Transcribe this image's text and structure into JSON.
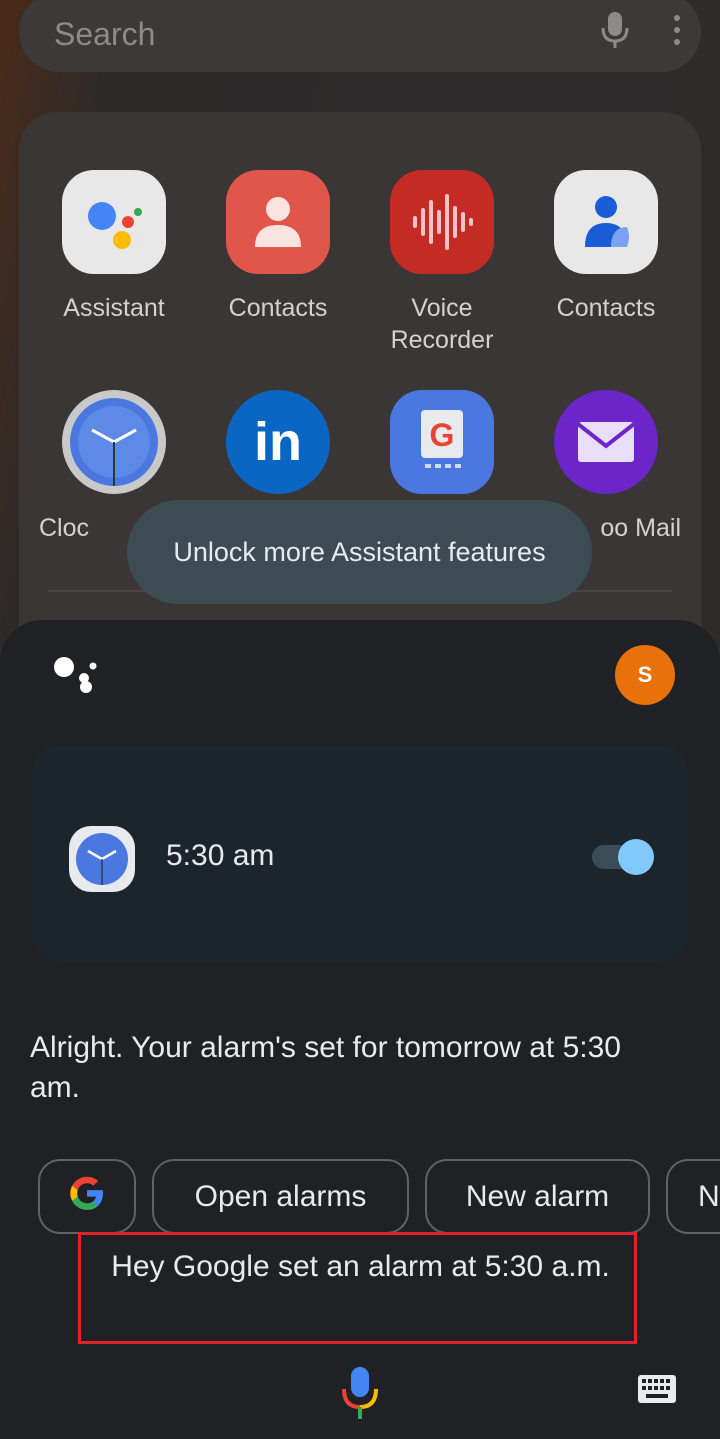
{
  "search": {
    "placeholder": "Search",
    "mic_icon": "mic-icon",
    "more_icon": "more-vert-icon"
  },
  "apps": [
    {
      "label": "Assistant",
      "icon": "google-assistant-icon",
      "color": "#e8e8e8"
    },
    {
      "label": "Contacts",
      "icon": "contacts-person-icon",
      "color": "#e0564a"
    },
    {
      "label": "Voice\nRecorder",
      "icon": "waveform-icon",
      "color": "#c52b25"
    },
    {
      "label": "Contacts",
      "icon": "contacts-samsung-icon",
      "color": "#e8e8e8"
    },
    {
      "label": "Cloc",
      "icon": "clock-icon",
      "color": "#c9c9c9"
    },
    {
      "label": "",
      "icon": "linkedin-icon",
      "color": "#0a66c2"
    },
    {
      "label": "",
      "icon": "gboard-icon",
      "color": "#4a78e0"
    },
    {
      "label": "oo Mail",
      "icon": "mail-icon",
      "color": "#6b25c9"
    }
  ],
  "tooltip": "Unlock more Assistant features",
  "assistant": {
    "avatar_letter": "S",
    "alarm_time": "5:30 am",
    "alarm_enabled": true,
    "response": "Alright. Your alarm's set for tomorrow at 5:30 am.",
    "chips": [
      "Open alarms",
      "New alarm",
      "N"
    ],
    "query": "Hey Google set an alarm at 5:30 a.m."
  },
  "colors": {
    "highlight_box": "#e0202a",
    "toggle_on": "#81c9fa",
    "avatar": "#e8710a"
  }
}
